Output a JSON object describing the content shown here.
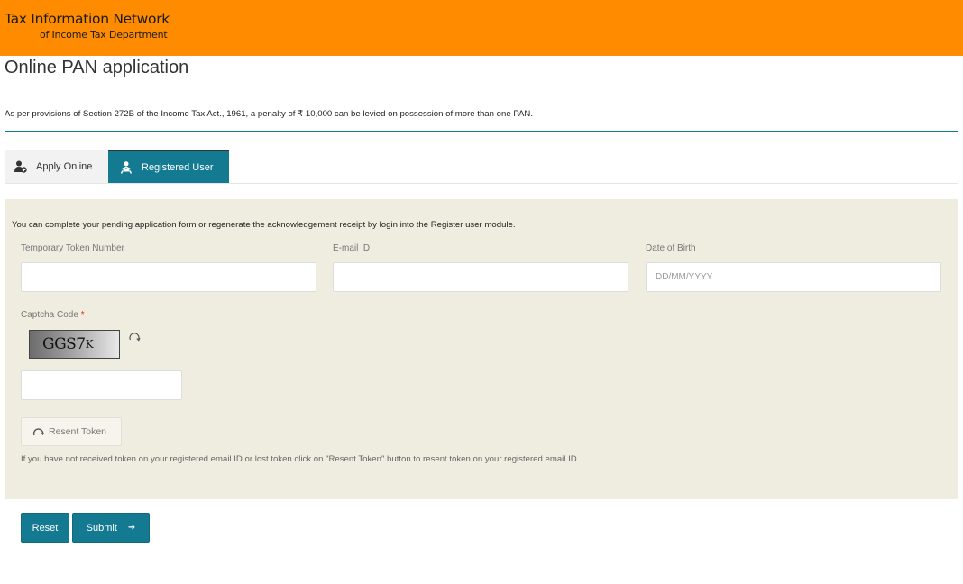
{
  "header": {
    "title": "Tax Information Network",
    "subtitle": "of Income Tax Department",
    "background_color": "#ff8c00"
  },
  "page": {
    "title": "Online PAN application",
    "penalty_note": "As per provisions of Section 272B of the Income Tax Act., 1961, a penalty of ₹ 10,000 can be levied on possession of more than one PAN."
  },
  "tabs": [
    {
      "label": "Apply Online",
      "icon": "user-add-icon",
      "active": false
    },
    {
      "label": "Registered User",
      "icon": "registered-user-icon",
      "active": true
    }
  ],
  "form": {
    "intro": "You can complete your pending application form or regenerate the acknowledgement receipt by login into the Register user module.",
    "fields": {
      "token": {
        "label": "Temporary Token Number",
        "value": "",
        "placeholder": ""
      },
      "email": {
        "label": "E-mail ID",
        "value": "",
        "placeholder": ""
      },
      "dob": {
        "label": "Date of Birth",
        "value": "",
        "placeholder": "DD/MM/YYYY"
      }
    },
    "captcha": {
      "label": "Captcha Code",
      "required_marker": "*",
      "image_text_main": "GGS7",
      "image_text_small": "K",
      "input_value": ""
    },
    "resent_token": {
      "label": "Resent Token",
      "note": "If you have not received token on your registered email ID or lost token click on \"Resent Token\" button to resent token on your registered email ID."
    },
    "buttons": {
      "reset": "Reset",
      "submit": "Submit",
      "submit_icon": "➜"
    }
  },
  "colors": {
    "accent": "#137a92",
    "panel_bg": "#efede0"
  }
}
